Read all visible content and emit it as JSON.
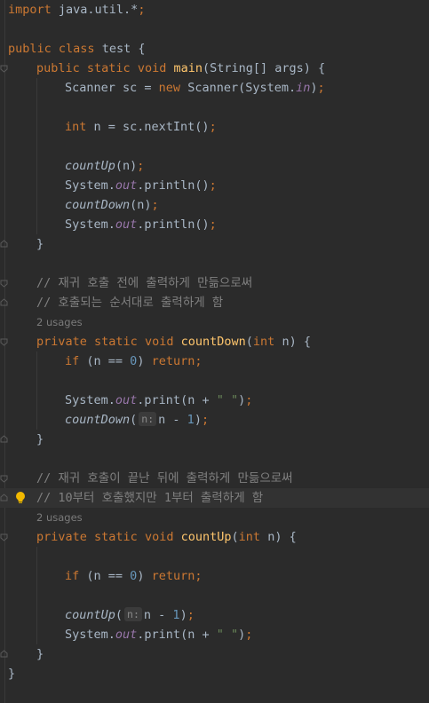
{
  "editor": {
    "lines": {
      "l1": {
        "kw": "import",
        "rest": " java.util.*",
        "semi": ";"
      },
      "l3": {
        "kw1": "public",
        "kw2": "class",
        "name": "test",
        "brace": "{"
      },
      "l4": {
        "kw1": "public",
        "kw2": "static",
        "kw3": "void",
        "fn": "main",
        "args": "(String[] args) {"
      },
      "l5": {
        "pre": "Scanner sc = ",
        "kw": "new",
        "mid": " Scanner(System.",
        "field": "in",
        "end": ")",
        "semi": ";"
      },
      "l7": {
        "kw": "int",
        "rest": " n = sc.nextInt()",
        "semi": ";"
      },
      "l9": {
        "call": "countUp",
        "rest": "(n)",
        "semi": ";"
      },
      "l10": {
        "pre": "System.",
        "field": "out",
        "rest": ".println()",
        "semi": ";"
      },
      "l11": {
        "call": "countDown",
        "rest": "(n)",
        "semi": ";"
      },
      "l12": {
        "pre": "System.",
        "field": "out",
        "rest": ".println()",
        "semi": ";"
      },
      "l13": {
        "brace": "}"
      },
      "l15": {
        "comment": "// 재귀 호출 전에 출력하게 만듦으로써"
      },
      "l16": {
        "comment": "// 호출되는 순서대로 출력하게 함"
      },
      "u1": {
        "usages": "2 usages"
      },
      "l17": {
        "kw1": "private",
        "kw2": "static",
        "kw3": "void",
        "fn": "countDown",
        "kwint": "int",
        "args": " n) {"
      },
      "l18": {
        "kw": "if",
        "mid": " (n == ",
        "num": "0",
        "close": ") ",
        "kwret": "return",
        "semi": ";"
      },
      "l20": {
        "pre": "System.",
        "field": "out",
        "mid": ".print(n + ",
        "str": "\" \"",
        "close": ")",
        "semi": ";"
      },
      "l21": {
        "call": "countDown",
        "open": "(",
        "hint": "n:",
        "mid": "n - ",
        "num": "1",
        "close": ")",
        "semi": ";"
      },
      "l22": {
        "brace": "}"
      },
      "l24": {
        "comment": "// 재귀 호출이 끝난 뒤에 출력하게 만듦으로써"
      },
      "l25": {
        "comment": "// 10부터 호출했지만 1부터 출력하게 함"
      },
      "u2": {
        "usages": "2 usages"
      },
      "l26": {
        "kw1": "private",
        "kw2": "static",
        "kw3": "void",
        "fn": "countUp",
        "kwint": "int",
        "args": " n) {"
      },
      "l28": {
        "kw": "if",
        "mid": " (n == ",
        "num": "0",
        "close": ") ",
        "kwret": "return",
        "semi": ";"
      },
      "l30": {
        "call": "countUp",
        "open": "(",
        "hint": "n:",
        "mid": "n - ",
        "num": "1",
        "close": ")",
        "semi": ";"
      },
      "l31": {
        "pre": "System.",
        "field": "out",
        "mid": ".print(n + ",
        "str": "\" \"",
        "close": ")",
        "semi": ";"
      },
      "l32": {
        "brace": "}"
      },
      "l33": {
        "brace": "}"
      }
    },
    "icons": {
      "fold": "fold-marker-icon",
      "bulb": "lightbulb-icon"
    },
    "colors": {
      "background": "#2b2b2b",
      "keyword": "#cc7832",
      "function": "#ffc66d",
      "number": "#6897bb",
      "string": "#6a8759",
      "field": "#9876aa",
      "comment": "#808080",
      "bulb": "#f2b900"
    }
  }
}
